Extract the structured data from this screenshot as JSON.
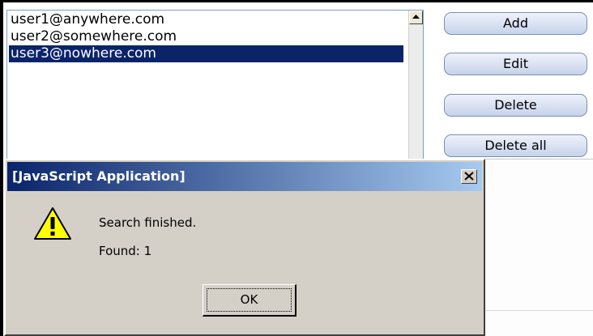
{
  "email_list": {
    "items": [
      {
        "label": "user1@anywhere.com",
        "selected": false
      },
      {
        "label": "user2@somewhere.com",
        "selected": false
      },
      {
        "label": "user3@nowhere.com",
        "selected": true
      }
    ]
  },
  "buttons": {
    "add": "Add",
    "edit": "Edit",
    "delete": "Delete",
    "delete_all": "Delete all"
  },
  "dialog": {
    "title": "[JavaScript Application]",
    "icon": "warning-icon",
    "message_line1": "Search finished.",
    "message_line2": "Found: 1",
    "ok_label": "OK"
  },
  "colors": {
    "selection": "#0a246a",
    "titlebar_start": "#0a246a",
    "titlebar_end": "#a6caf0",
    "dialog_face": "#d4d0c8"
  }
}
